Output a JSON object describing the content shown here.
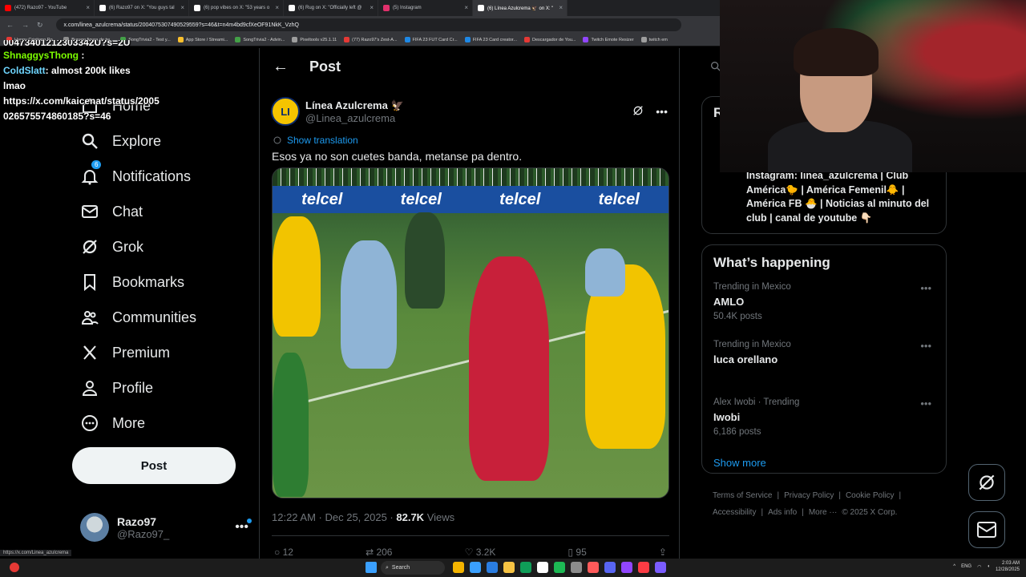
{
  "browser": {
    "tabs": [
      {
        "label": "(472) Razo97 - YouTube",
        "color": "#ff0000"
      },
      {
        "label": "(6) Razo97 on X: \"You guys tal",
        "color": "#ffffff"
      },
      {
        "label": "(6) pop vibes on X: \"53 years o",
        "color": "#ffffff"
      },
      {
        "label": "(6) Rug on X: \"Officially left @",
        "color": "#ffffff"
      },
      {
        "label": "(5) Instagram",
        "color": "#e1306c"
      },
      {
        "label": "(6) Línea Azulcrema 🦅 on X: \"",
        "color": "#ffffff"
      }
    ],
    "url": "x.com/linea_azulcrema/status/2004075307490529559?s=46&t=n4m4bd9cfXeOF91NkK_VzhQ",
    "bookmarks": [
      {
        "label": "Happy Cristiano Ro...",
        "color": "#e53935"
      },
      {
        "label": "Buraqo figura de tw...",
        "color": "#8e8e8e"
      },
      {
        "label": "SongTrivia2 - Test y...",
        "color": "#43a047"
      },
      {
        "label": "App Store / Streami...",
        "color": "#fbc02d"
      },
      {
        "label": "SongTrivia2 - Advin...",
        "color": "#43a047"
      },
      {
        "label": "Pixeltools v25.1.11",
        "color": "#9e9e9e"
      },
      {
        "label": "(77) Razo97's Zest-A...",
        "color": "#e53935"
      },
      {
        "label": "FIFA 23 FUT Card Cr...",
        "color": "#1e88e5"
      },
      {
        "label": "FIFA 23 Card creator...",
        "color": "#1e88e5"
      },
      {
        "label": "Descargador de You...",
        "color": "#e53935"
      },
      {
        "label": "Twitch Emote Resizer",
        "color": "#9146ff"
      },
      {
        "label": "twitch em",
        "color": "#9e9e9e"
      }
    ],
    "status_url": "https://x.com/Linea_azulcrema"
  },
  "chat": {
    "line0": "00473401212303342U?s=2U",
    "user1": "ShnaggysThong",
    "user2": "ColdSlatt",
    "msg2": ": almost 200k likes",
    "msg3": "lmao",
    "msg4": "https://x.com/kaicenat/status/2005",
    "msg5": "026575574860185?s=46"
  },
  "nav": {
    "items": [
      {
        "label": "Home",
        "icon": "home-icon"
      },
      {
        "label": "Explore",
        "icon": "search-icon"
      },
      {
        "label": "Notifications",
        "icon": "bell-icon",
        "badge": "6"
      },
      {
        "label": "Chat",
        "icon": "mail-icon"
      },
      {
        "label": "Grok",
        "icon": "grok-icon"
      },
      {
        "label": "Bookmarks",
        "icon": "bookmark-icon"
      },
      {
        "label": "Communities",
        "icon": "people-icon"
      },
      {
        "label": "Premium",
        "icon": "x-logo-icon"
      },
      {
        "label": "Profile",
        "icon": "person-icon"
      },
      {
        "label": "More",
        "icon": "more-circle-icon"
      }
    ],
    "post_label": "Post",
    "account_name": "Razo97",
    "account_handle": "@Razo97_",
    "more": "•••"
  },
  "main": {
    "back": "←",
    "title": "Post",
    "author_name": "Línea Azulcrema 🦅",
    "author_handle": "@Linea_azulcrema",
    "avatar_text": "LI",
    "more": "•••",
    "show_translation": "Show translation",
    "text": "Esos ya no son cuetes banda, metanse pa dentro.",
    "ad_word": "telcel",
    "timestamp": "12:22 AM · Dec 25, 2025 · ",
    "views_count": "82.7K",
    "views_label": " Views",
    "replies": "12",
    "reposts": "206",
    "likes": "3.2K",
    "bookmarks": "95"
  },
  "right": {
    "card_letter": "R",
    "bio": "Instagram: linea_azulcrema | Club América🐤 | América Femenil🐥 | América FB 🐣 | Noticias al minuto del club | canal de youtube 👇🏻",
    "happening_title": "What’s happening",
    "trends": [
      {
        "context": "Trending in Mexico",
        "name": "AMLO",
        "count": "50.4K posts"
      },
      {
        "context": "Trending in Mexico",
        "name": "luca orellano",
        "count": ""
      },
      {
        "context": "Alex Iwobi · Trending",
        "name": "Iwobi",
        "count": "6,186 posts"
      }
    ],
    "show_more": "Show more",
    "footer": {
      "terms": "Terms of Service",
      "privacy": "Privacy Policy",
      "cookie": "Cookie Policy",
      "access": "Accessibility",
      "ads": "Ads info",
      "more": "More ···",
      "copy": "© 2025 X Corp."
    }
  },
  "taskbar": {
    "search": "Search",
    "lang": "ENG",
    "time": "2:03 AM",
    "date": "12/28/2025"
  },
  "colors": {
    "accent": "#1d9bf0",
    "background": "#000000",
    "border": "#2f3336"
  }
}
